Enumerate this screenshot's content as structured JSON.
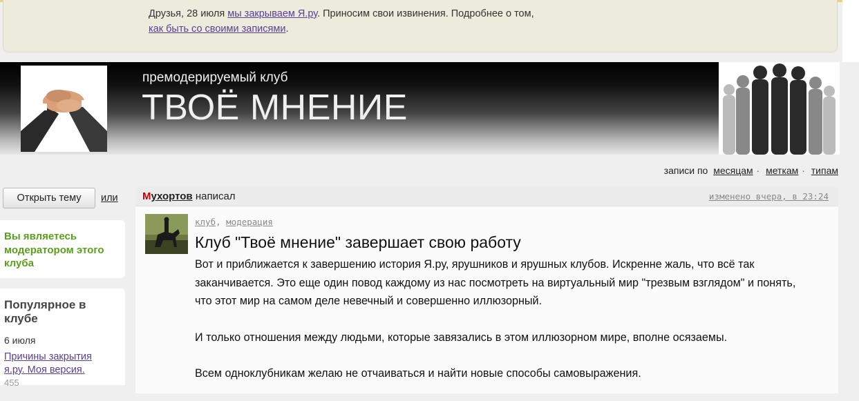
{
  "notice": {
    "prefix": "Друзья, 28 июля",
    "link1": "мы закрываем Я.ру",
    "middle": ". Приносим свои извинения. Подробнее о том,",
    "link2": "как быть со своими записями",
    "suffix": "."
  },
  "header": {
    "club_type": "премодерируемый клуб",
    "club_name": "ТВОЁ МНЕНИЕ"
  },
  "sort": {
    "label": "записи по",
    "options": [
      "месяцам",
      "меткам",
      "типам"
    ],
    "separator": "·"
  },
  "sidebar": {
    "open_topic": "Открыть тему",
    "or": "или",
    "moderator_notice": "Вы являетесь модератором этого клуба",
    "popular_title": "Популярное в клубе",
    "popular_date": "6 июля",
    "popular_link": "Причины закрытия я.ру. Моя версия.",
    "popular_count": "455"
  },
  "post": {
    "author_first": "М",
    "author_rest": "ухортов",
    "wrote": "написал",
    "changed": "изменено вчера, в 23:24",
    "tags": [
      "клуб",
      "модерация"
    ],
    "title": "Клуб \"Твоё мнение\" завершает свою работу",
    "paragraphs": [
      "Вот и приближается к завершению история Я.ру, ярушников и ярушных клубов. Искренне жаль, что всё так заканчивается. Это еще один повод каждому из нас посмотреть на виртуальный мир \"трезвым взглядом\" и понять, что этот мир на самом деле невечный и совершенно иллюзорный.",
      "И только отношения между людьми, которые завязались в этом иллюзорном мире, вполне осязаемы.",
      "Всем одноклубникам желаю не отчаиваться и найти новые способы самовыражения."
    ]
  },
  "colors": {
    "accent_link": "#5a3e94",
    "moderator_green": "#5a9e1e",
    "author_red": "#cc0000"
  }
}
